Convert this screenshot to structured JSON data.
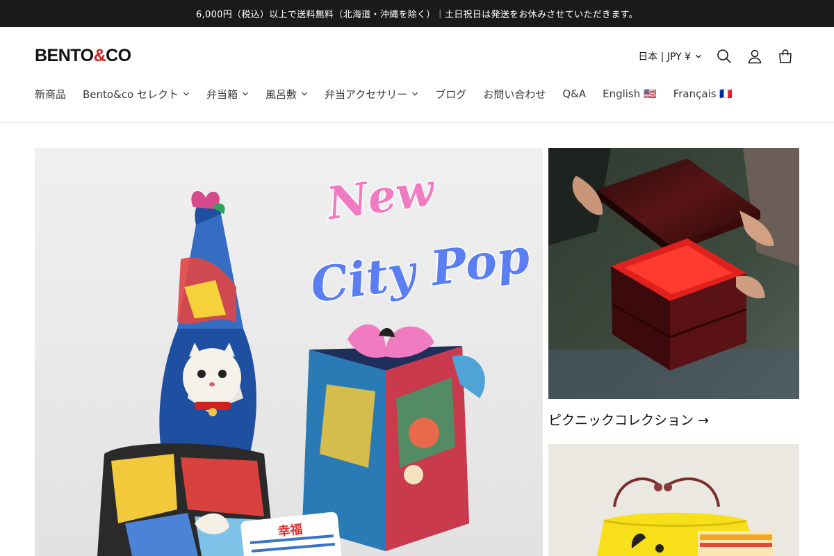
{
  "announcement": {
    "text": "6,000円（税込）以上で送料無料（北海道・沖縄を除く）｜土日祝日は発送をお休みさせていただきます。"
  },
  "header": {
    "logo": {
      "part1": "BENTO",
      "amp": "&",
      "part2": "CO"
    },
    "country_selector": "日本 | JPY ¥",
    "icons": [
      "search-icon",
      "account-icon",
      "cart-icon"
    ]
  },
  "nav": {
    "items": [
      {
        "label": "新商品"
      },
      {
        "label": "Bento&co セレクト"
      },
      {
        "label": "弁当箱"
      },
      {
        "label": "風呂敷"
      },
      {
        "label": "弁当アクセサリー"
      },
      {
        "label": "ブログ"
      },
      {
        "label": "お問い合わせ"
      },
      {
        "label": "Q&A"
      },
      {
        "label": "English 🇺🇸"
      },
      {
        "label": "Français 🇫🇷"
      }
    ]
  },
  "hero": {
    "headline_line1": "New",
    "headline_line2": "City Pop",
    "card_text": "幸福"
  },
  "collections": {
    "picnic_link": "ピクニックコレクション →"
  },
  "colors": {
    "announcement_bg": "#1a1a1a",
    "logo_ampersand": "#d4211b",
    "hero_pink": "#f07bc0",
    "hero_blue": "#5b7ff2"
  }
}
